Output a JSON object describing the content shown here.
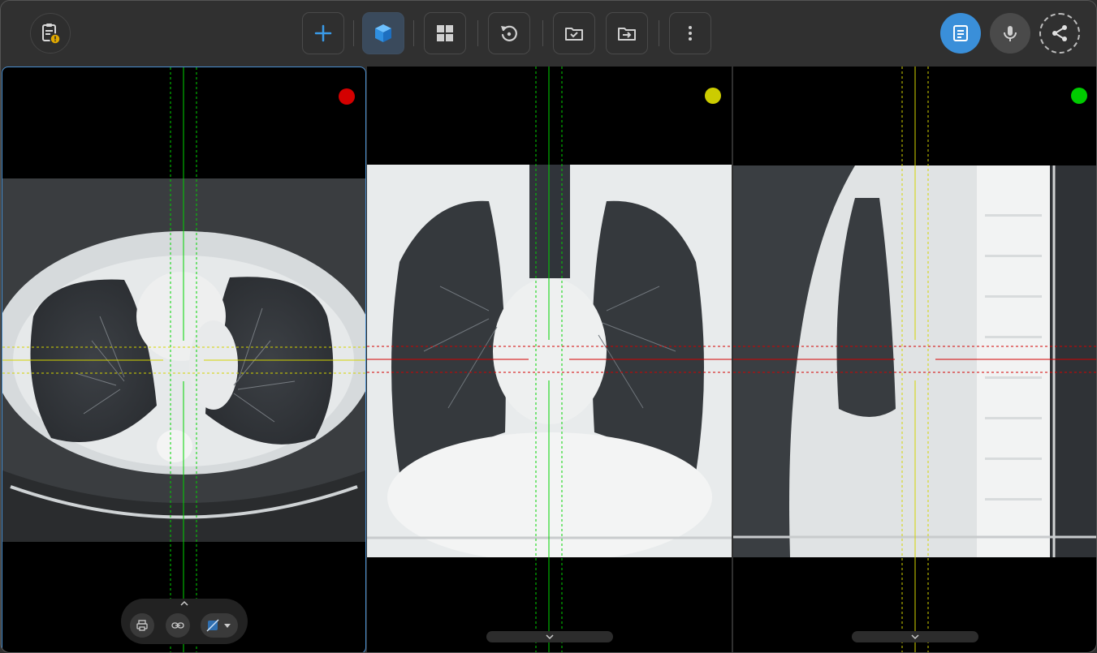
{
  "toolbar": {
    "buttons": [
      {
        "name": "add-button",
        "icon": "plus-icon"
      },
      {
        "name": "3d-cube-button",
        "icon": "cube-icon",
        "active": true
      },
      {
        "name": "layout-grid-button",
        "icon": "grid-icon"
      },
      {
        "name": "reset-button",
        "icon": "rotate-ccw-icon"
      },
      {
        "name": "folder-check-button",
        "icon": "folder-check-icon"
      },
      {
        "name": "folder-export-button",
        "icon": "folder-arrow-icon"
      },
      {
        "name": "more-button",
        "icon": "more-vertical-icon"
      }
    ],
    "report_button": {
      "icon": "clipboard-warning-icon"
    },
    "right": [
      {
        "name": "notes-button",
        "icon": "document-icon",
        "color": "#3a8fd9"
      },
      {
        "name": "microphone-button",
        "icon": "mic-icon"
      },
      {
        "name": "share-button",
        "icon": "share-icon"
      }
    ]
  },
  "viewports": [
    {
      "name": "axial",
      "marker_color": "#d40000",
      "h_line_color": "#d4d400",
      "v_line_color": "#00d400"
    },
    {
      "name": "coronal",
      "marker_color": "#cccc00",
      "h_line_color": "#d40000",
      "v_line_color": "#00d400"
    },
    {
      "name": "sagittal",
      "marker_color": "#00cc00",
      "h_line_color": "#d40000",
      "v_line_color": "#d4d400"
    }
  ],
  "colors": {
    "accent": "#3a8fd9",
    "background": "#303030"
  }
}
